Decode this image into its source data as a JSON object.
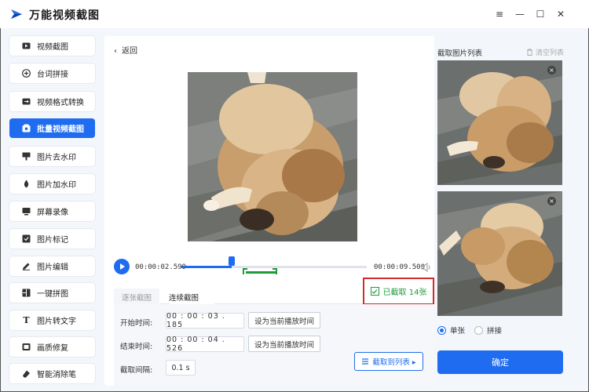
{
  "app": {
    "title": "万能视频截图"
  },
  "window_controls": {
    "menu": "≡",
    "minimize": "—",
    "maximize": "☐",
    "close": "✕"
  },
  "sidebar": {
    "items": [
      {
        "label": "视频截图",
        "icon": "video-icon"
      },
      {
        "label": "台词拼接",
        "icon": "subtitle-icon"
      },
      {
        "label": "视频格式转换",
        "icon": "convert-icon"
      },
      {
        "label": "批量视频截图",
        "icon": "batch-icon",
        "active": true
      },
      {
        "label": "图片去水印",
        "icon": "remove-watermark-icon"
      },
      {
        "label": "图片加水印",
        "icon": "add-watermark-icon"
      },
      {
        "label": "屏幕录像",
        "icon": "screen-record-icon"
      },
      {
        "label": "图片标记",
        "icon": "mark-icon"
      },
      {
        "label": "图片编辑",
        "icon": "edit-icon"
      },
      {
        "label": "一键拼图",
        "icon": "collage-icon"
      },
      {
        "label": "图片转文字",
        "icon": "text-icon"
      },
      {
        "label": "画质修复",
        "icon": "repair-icon"
      },
      {
        "label": "智能消除笔",
        "icon": "eraser-icon"
      }
    ]
  },
  "main": {
    "back_label": "返回",
    "player": {
      "current_time": "00:00:02.599",
      "total_time": "00:00:09.500",
      "progress": 0.27
    },
    "tabs": [
      {
        "label": "逐张截图"
      },
      {
        "label": "连续截图"
      }
    ],
    "captured_label": "已截取 14张",
    "settings": {
      "start_label": "开始时间:",
      "start_value": "00 : 00 : 03 . 185",
      "end_label": "结束时间:",
      "end_value": "00 : 00 : 04 . 526",
      "interval_label": "截取间隔:",
      "interval_value": "0.1  s",
      "set_current_label": "设为当前播放时间",
      "capture_button": "截取到列表 ▸"
    }
  },
  "right_panel": {
    "title": "截取图片列表",
    "clear_label": "清空列表",
    "options": [
      {
        "label": "单张",
        "selected": true
      },
      {
        "label": "拼接",
        "selected": false
      }
    ],
    "confirm_label": "确定"
  },
  "colors": {
    "accent": "#1f6cf0",
    "success": "#1c9b3a",
    "highlight_border": "#d32a2a"
  }
}
